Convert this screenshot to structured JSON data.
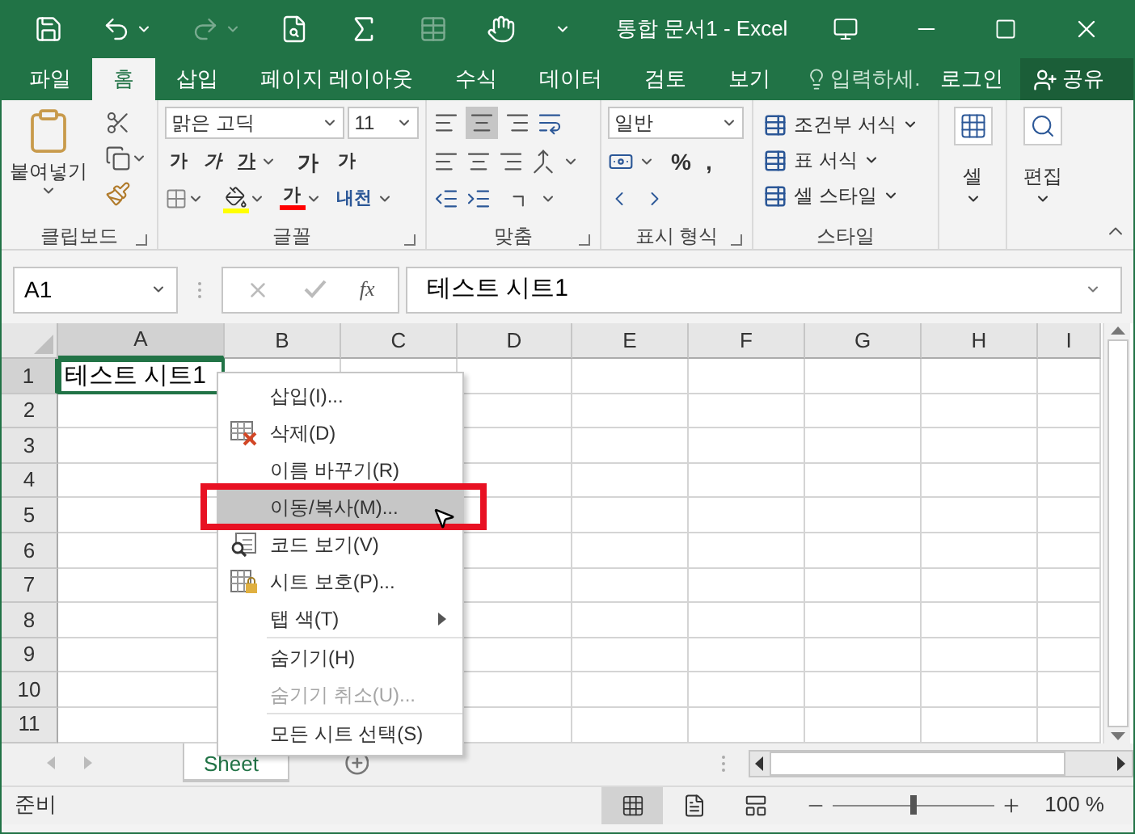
{
  "title_bar": {
    "title": "통합 문서1 - Excel"
  },
  "ribbon_tabs": [
    {
      "label": "파일",
      "selected": false
    },
    {
      "label": "홈",
      "selected": true
    },
    {
      "label": "삽입",
      "selected": false
    },
    {
      "label": "페이지 레이아웃",
      "selected": false
    },
    {
      "label": "수식",
      "selected": false
    },
    {
      "label": "데이터",
      "selected": false
    },
    {
      "label": "검토",
      "selected": false
    },
    {
      "label": "보기",
      "selected": false
    }
  ],
  "tell_me": {
    "placeholder": "입력하세."
  },
  "sign_in": "로그인",
  "share": "공유",
  "ribbon": {
    "clipboard": {
      "paste": "붙여넣기",
      "label": "클립보드"
    },
    "font": {
      "font_name": "맑은 고딕",
      "font_size": "11",
      "bold": "가",
      "italic": "가",
      "underline": "가",
      "grow": "가",
      "shrink": "가",
      "font_color": "가",
      "phonetic": "내천",
      "label": "글꼴"
    },
    "alignment": {
      "label": "맞춤"
    },
    "number": {
      "format": "일반",
      "percent": "%",
      "comma": ",",
      "label": "표시 형식"
    },
    "styles": {
      "items": [
        "조건부 서식",
        "표 서식",
        "셀 스타일"
      ],
      "label": "스타일"
    },
    "cells": {
      "label": "셀"
    },
    "editing": {
      "label": "편집"
    }
  },
  "formula_bar": {
    "name_box": "A1",
    "fx": "fx",
    "value": "테스트 시트1"
  },
  "sheet": {
    "columns": [
      {
        "label": "A",
        "selected": true
      },
      {
        "label": "B",
        "selected": false
      },
      {
        "label": "C",
        "selected": false
      },
      {
        "label": "D",
        "selected": false
      },
      {
        "label": "E",
        "selected": false
      },
      {
        "label": "F",
        "selected": false
      },
      {
        "label": "G",
        "selected": false
      },
      {
        "label": "H",
        "selected": false
      },
      {
        "label": "I",
        "selected": false
      }
    ],
    "rows": [
      {
        "label": "1",
        "selected": true
      },
      {
        "label": "2",
        "selected": false
      },
      {
        "label": "3",
        "selected": false
      },
      {
        "label": "4",
        "selected": false
      },
      {
        "label": "5",
        "selected": false
      },
      {
        "label": "6",
        "selected": false
      },
      {
        "label": "7",
        "selected": false
      },
      {
        "label": "8",
        "selected": false
      },
      {
        "label": "9",
        "selected": false
      },
      {
        "label": "10",
        "selected": false
      },
      {
        "label": "11",
        "selected": false
      }
    ],
    "active_cell": {
      "text": "테스트 시트1"
    }
  },
  "context_menu": [
    {
      "kind": "plain",
      "label": "삽입(I)...",
      "disabled": false,
      "selected": false,
      "highlighted": false
    },
    {
      "kind": "delete",
      "label": "삭제(D)",
      "disabled": false,
      "selected": false,
      "highlighted": false
    },
    {
      "kind": "plain",
      "label": "이름 바꾸기(R)",
      "disabled": false,
      "selected": false,
      "highlighted": false
    },
    {
      "kind": "plain",
      "label": "이동/복사(M)...",
      "disabled": false,
      "selected": true,
      "highlighted": true
    },
    {
      "kind": "code",
      "label": "코드 보기(V)",
      "disabled": false,
      "selected": false,
      "highlighted": false
    },
    {
      "kind": "protect",
      "label": "시트 보호(P)...",
      "disabled": false,
      "selected": false,
      "highlighted": false
    },
    {
      "kind": "submenu",
      "label": "탭 색(T)",
      "disabled": false,
      "selected": false,
      "highlighted": false
    },
    {
      "kind": "separator"
    },
    {
      "kind": "plain",
      "label": "숨기기(H)",
      "disabled": false,
      "selected": false,
      "highlighted": false
    },
    {
      "kind": "plain",
      "label": "숨기기 취소(U)...",
      "disabled": true,
      "selected": false,
      "highlighted": false
    },
    {
      "kind": "separator"
    },
    {
      "kind": "plain",
      "label": "모든 시트 선택(S)",
      "disabled": false,
      "selected": false,
      "highlighted": false
    }
  ],
  "sheet_tabs": [
    {
      "label": "Sheet",
      "selected": true
    }
  ],
  "status_bar": {
    "status": "준비",
    "zoom": "100 %",
    "zoom_level": {
      "level": 0.5
    }
  }
}
